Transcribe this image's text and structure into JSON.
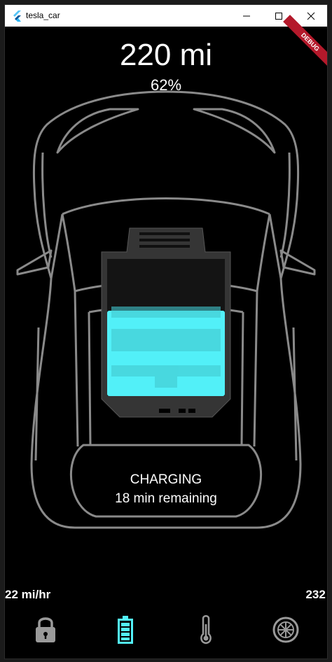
{
  "window": {
    "title": "tesla_car"
  },
  "debug_banner": "DEBUG",
  "battery": {
    "range": "220 mi",
    "percent": "62%",
    "level": 0.62,
    "status": "CHARGING",
    "time_remaining": "18 min remaining"
  },
  "stats": {
    "speed": "22 mi/hr",
    "voltage": "232 v"
  },
  "nav": [
    {
      "icon": "lock-icon",
      "active": false
    },
    {
      "icon": "battery-icon",
      "active": true
    },
    {
      "icon": "thermometer-icon",
      "active": false
    },
    {
      "icon": "tire-icon",
      "active": false
    }
  ],
  "colors": {
    "accent": "#52f0f8",
    "car_outline": "#888888",
    "nav_inactive": "#9a9a9a"
  }
}
